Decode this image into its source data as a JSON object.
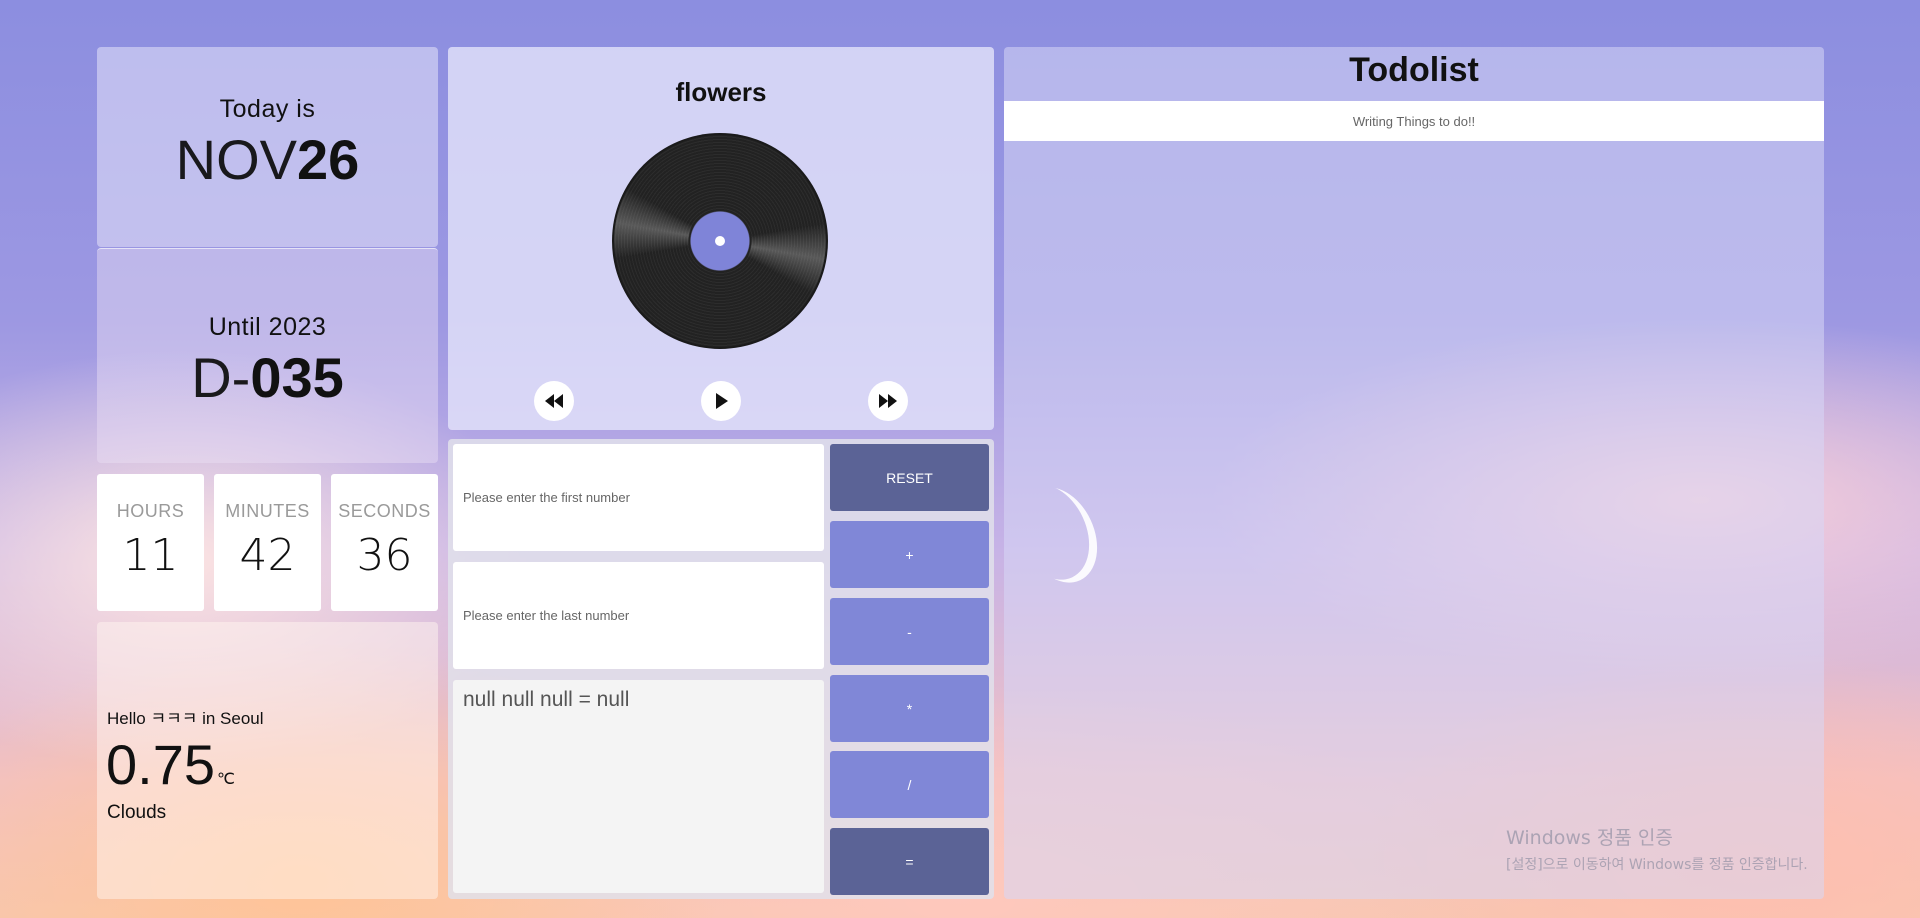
{
  "date": {
    "label": "Today is",
    "month": "NOV",
    "day": "26"
  },
  "dday": {
    "label": "Until 2023",
    "prefix": "D-",
    "count": "035"
  },
  "clock": {
    "hours_label": "HOURS",
    "hours": "11",
    "minutes_label": "MINUTES",
    "minutes": "42",
    "seconds_label": "SECONDS",
    "seconds": "36"
  },
  "weather": {
    "greeting": "Hello ㅋㅋㅋ in Seoul",
    "temp": "0.75",
    "unit": "℃",
    "description": "Clouds"
  },
  "music": {
    "title": "flowers",
    "controls": [
      "rewind-icon",
      "play-icon",
      "fast-forward-icon"
    ]
  },
  "calculator": {
    "first_placeholder": "Please enter the first number",
    "last_placeholder": "Please enter the last number",
    "result": "null null null = null",
    "buttons": {
      "reset": "RESET",
      "plus": "+",
      "minus": "-",
      "multiply": "*",
      "divide": "/",
      "equals": "="
    }
  },
  "todo": {
    "title": "Todolist",
    "placeholder": "Writing Things to do!!"
  },
  "windows_watermark": {
    "title": "Windows 정품 인증",
    "subtitle": "[설정]으로 이동하여 Windows를 정품 인증합니다."
  },
  "colors": {
    "accent": "#8087d7",
    "accent_dark": "#5b6396"
  }
}
